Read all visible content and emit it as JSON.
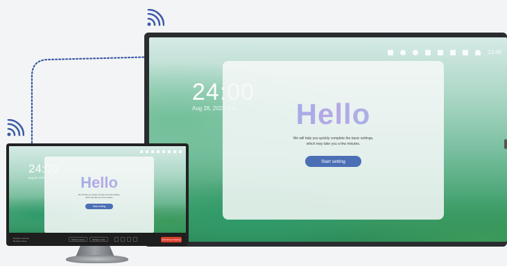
{
  "large_display": {
    "clock": "24:00",
    "date": "Aug 28, 2023  Thu",
    "status_time": "13:45",
    "status_icons": [
      "screen-icon",
      "volume-icon",
      "brightness-icon",
      "person-icon",
      "file-icon",
      "camera-icon",
      "network-icon",
      "wifi-icon"
    ],
    "dialog": {
      "title": "Hello",
      "subtitle_line1": "We will help you quickly complete the basic settings,",
      "subtitle_line2": "which may take you a few minutes.",
      "button_label": "Start setting"
    }
  },
  "small_monitor": {
    "clock": "24:00",
    "date": "Aug 28, 2023",
    "dialog": {
      "title": "Hello",
      "subtitle_line1": "We will help you quickly complete the basic settings,",
      "subtitle_line2": "which may take you a few minutes.",
      "button_label": "Start setting"
    },
    "taskbar": {
      "info_line1": "Receive Connect",
      "info_line2": "Receive name",
      "select1": "Default screen",
      "select2": "Multiple mode",
      "exit_label": "Exit Screen Sharing"
    }
  },
  "colors": {
    "accent": "#4b6fb5",
    "wifi": "#3b5aa6",
    "exit": "#d9412f"
  }
}
